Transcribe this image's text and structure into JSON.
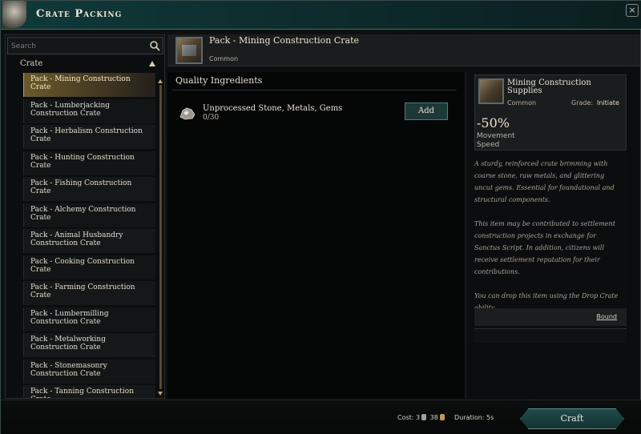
{
  "window": {
    "title": "Crate Packing",
    "close_label": "×"
  },
  "search": {
    "placeholder": "Search"
  },
  "category": {
    "label": "Crate"
  },
  "recipes": [
    {
      "label": "Pack - Mining Construction Crate",
      "selected": true
    },
    {
      "label": "Pack - Lumberjacking Construction Crate"
    },
    {
      "label": "Pack - Herbalism Construction Crate"
    },
    {
      "label": "Pack - Hunting Construction Crate"
    },
    {
      "label": "Pack - Fishing Construction Crate"
    },
    {
      "label": "Pack - Alchemy Construction Crate"
    },
    {
      "label": "Pack - Animal Husbandry Construction Crate"
    },
    {
      "label": "Pack - Cooking Construction Crate"
    },
    {
      "label": "Pack - Farming Construction Crate"
    },
    {
      "label": "Pack - Lumbermilling Construction Crate"
    },
    {
      "label": "Pack - Metalworking Construction Crate"
    },
    {
      "label": "Pack - Stonemasonry Construction Crate"
    },
    {
      "label": "Pack - Tanning Construction Crate"
    }
  ],
  "recipe": {
    "title": "Pack - Mining Construction Crate",
    "rarity": "Common"
  },
  "ingredients": {
    "section_title": "Quality Ingredients",
    "items": [
      {
        "name": "Unprocessed Stone, Metals, Gems",
        "count": "0/30",
        "add_label": "Add"
      }
    ]
  },
  "detail": {
    "name": "Mining Construction Supplies",
    "rarity": "Common",
    "grade_label": "Grade:",
    "grade_value": "Initiate",
    "stat_value": "-50%",
    "stat_label": "Movement Speed",
    "description": [
      "A sturdy, reinforced crate brimming with coarse stone, raw metals, and glittering uncut gems. Essential for foundational and structural components.",
      "This item may be contributed to settlement construction projects in exchange for Sanctus Script. In addition, citizens will receive settlement reputation for their contributions.",
      "You can drop this item using the Drop Crate ability."
    ],
    "bound_label": "Bound"
  },
  "footer": {
    "cost_label": "Cost:",
    "cost_silver": "3",
    "cost_gold": "38",
    "duration_label": "Duration:",
    "duration_value": "5s",
    "craft_label": "Craft"
  },
  "colors": {
    "accent_teal": "#1f4b4a",
    "selected_gold": "#6b5a2a"
  }
}
